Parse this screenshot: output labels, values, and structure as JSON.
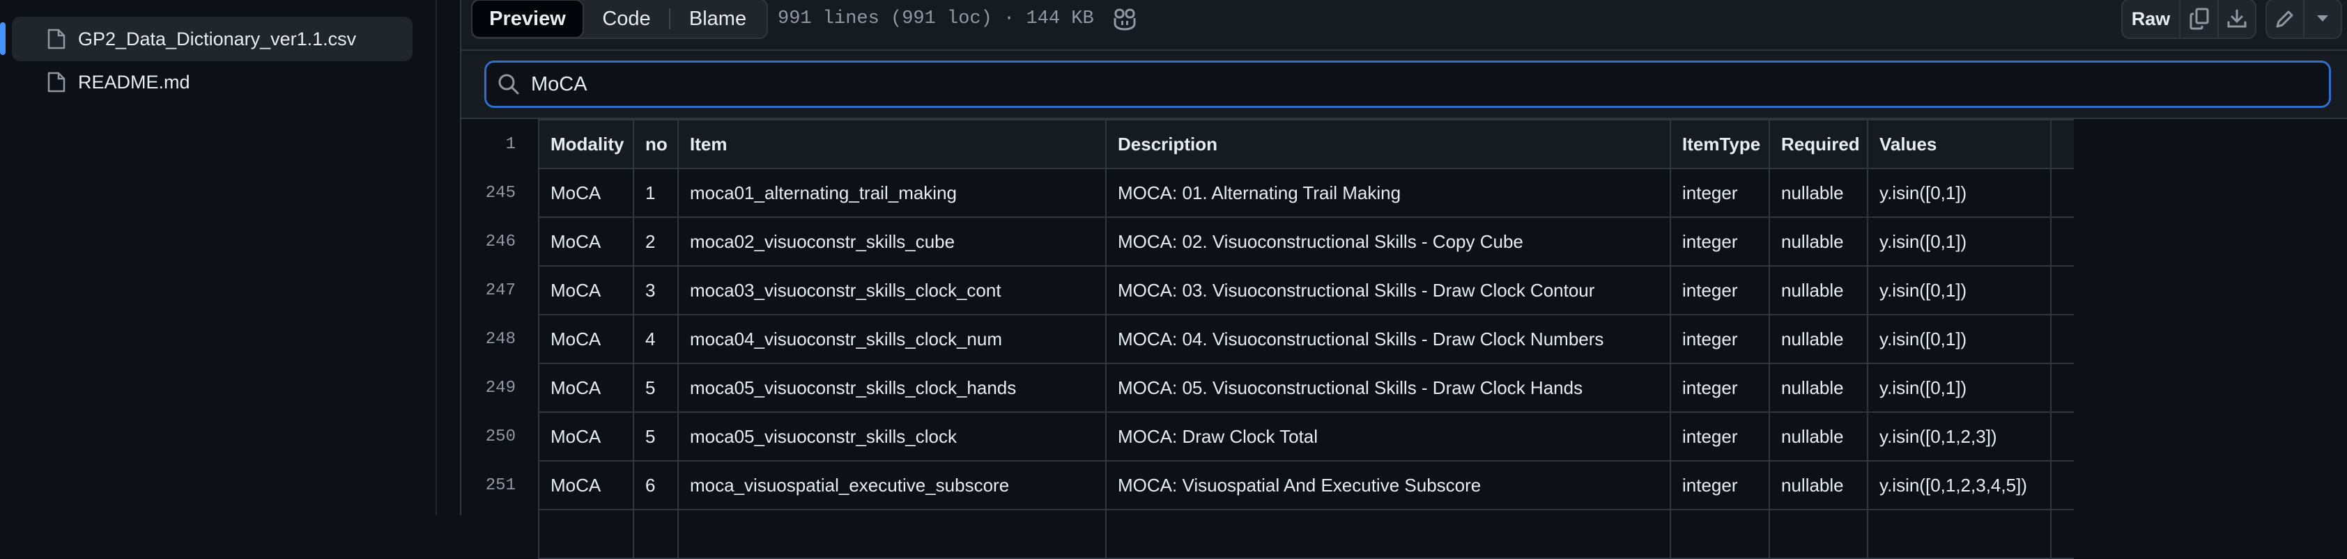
{
  "sidebar": {
    "files": [
      {
        "name": "GP2_Data_Dictionary_ver1.1.csv",
        "selected": true,
        "icon": "file-icon"
      },
      {
        "name": "README.md",
        "selected": false,
        "icon": "file-icon"
      }
    ]
  },
  "toolbar": {
    "tabs": [
      "Preview",
      "Code",
      "Blame"
    ],
    "active_tab": "Preview",
    "file_info": "991 lines (991 loc) · 144 KB",
    "raw_label": "Raw",
    "icons": [
      "copilot-icon",
      "copy-icon",
      "download-icon",
      "pencil-icon",
      "caret-down-icon"
    ]
  },
  "search": {
    "value": "MoCA",
    "icon": "search-icon"
  },
  "table": {
    "header_line": "1",
    "columns": [
      "Modality",
      "no",
      "Item",
      "Description",
      "ItemType",
      "Required",
      "Values"
    ],
    "rows": [
      {
        "line": "245",
        "cells": [
          "MoCA",
          "1",
          "moca01_alternating_trail_making",
          "MOCA: 01. Alternating Trail Making",
          "integer",
          "nullable",
          "y.isin([0,1])"
        ]
      },
      {
        "line": "246",
        "cells": [
          "MoCA",
          "2",
          "moca02_visuoconstr_skills_cube",
          "MOCA: 02. Visuoconstructional Skills - Copy Cube",
          "integer",
          "nullable",
          "y.isin([0,1])"
        ]
      },
      {
        "line": "247",
        "cells": [
          "MoCA",
          "3",
          "moca03_visuoconstr_skills_clock_cont",
          "MOCA: 03. Visuoconstructional Skills - Draw Clock Contour",
          "integer",
          "nullable",
          "y.isin([0,1])"
        ]
      },
      {
        "line": "248",
        "cells": [
          "MoCA",
          "4",
          "moca04_visuoconstr_skills_clock_num",
          "MOCA: 04. Visuoconstructional Skills - Draw Clock Numbers",
          "integer",
          "nullable",
          "y.isin([0,1])"
        ]
      },
      {
        "line": "249",
        "cells": [
          "MoCA",
          "5",
          "moca05_visuoconstr_skills_clock_hands",
          "MOCA: 05. Visuoconstructional Skills - Draw Clock Hands",
          "integer",
          "nullable",
          "y.isin([0,1])"
        ]
      },
      {
        "line": "250",
        "cells": [
          "MoCA",
          "5",
          "moca05_visuoconstr_skills_clock",
          "MOCA: Draw Clock Total",
          "integer",
          "nullable",
          "y.isin([0,1,2,3])"
        ]
      },
      {
        "line": "251",
        "cells": [
          "MoCA",
          "6",
          "moca_visuospatial_executive_subscore",
          "MOCA: Visuospatial And Executive Subscore",
          "integer",
          "nullable",
          "y.isin([0,1,2,3,4,5])"
        ]
      },
      {
        "line": "",
        "cells": [
          "",
          "",
          "",
          "",
          "",
          "",
          ""
        ]
      }
    ]
  },
  "colors": {
    "accent": "#316dca",
    "background": "#0d1117",
    "border": "#30363d",
    "selected_indicator": "#4493f8"
  }
}
